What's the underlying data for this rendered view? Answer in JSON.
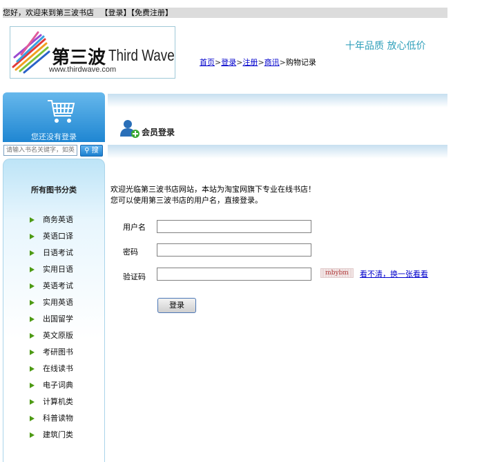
{
  "topbar": {
    "greeting": "您好，欢迎来到第三波书店",
    "login_link": "【登录】",
    "register_link": "【免费注册】"
  },
  "logo": {
    "cn": "第三波",
    "en": "Third Wave",
    "url": "www.thirdwave.com"
  },
  "slogan": "十年品质 放心低价",
  "breadcrumb": [
    {
      "label": "首页",
      "link": true
    },
    {
      "label": "登录",
      "link": true
    },
    {
      "label": "注册",
      "link": true
    },
    {
      "label": "商讯",
      "link": true
    },
    {
      "label": "购物记录",
      "link": false
    }
  ],
  "breadcrumb_sep": ">",
  "sidebar": {
    "cart_status": "您还没有登录",
    "search_placeholder": "请输入书名关键字，如英语",
    "search_button": "搜",
    "category_title": "所有图书分类",
    "categories": [
      "商务英语",
      "英语口译",
      "日语考试",
      "实用日语",
      "英语考试",
      "实用英语",
      "出国留学",
      "英文原版",
      "考研图书",
      "在线读书",
      "电子词典",
      "计算机类",
      "科普读物",
      "建筑门类"
    ]
  },
  "main": {
    "section_title": "会员登录",
    "welcome_line1": "欢迎光临第三波书店网站，本站为淘宝网旗下专业在线书店！",
    "welcome_line2": "您可以使用第三波书店的用户名，直接登录。",
    "username_label": "用户名",
    "password_label": "密码",
    "captcha_label": "验证码",
    "username_value": "",
    "password_value": "",
    "captcha_value": "",
    "captcha_text": "mbybm",
    "captcha_refresh": "看不清，换一张看看",
    "login_button": "登录"
  },
  "colors": {
    "accent_blue": "#1f86d2",
    "slogan": "#2f9fba",
    "link": "#0000cc",
    "arrow_green": "#4d9a14"
  }
}
